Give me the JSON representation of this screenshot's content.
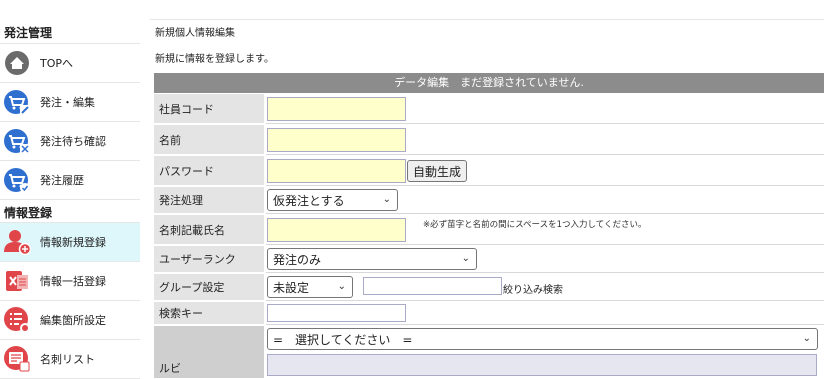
{
  "sidebar": {
    "order_section": "発注管理",
    "order_items": [
      {
        "label": "TOPへ",
        "icon": "home-icon"
      },
      {
        "label": "発注・編集",
        "icon": "cart-edit-icon"
      },
      {
        "label": "発注待ち確認",
        "icon": "cart-wait-icon"
      },
      {
        "label": "発注履歴",
        "icon": "cart-history-icon"
      }
    ],
    "info_section": "情報登録",
    "info_items": [
      {
        "label": "情報新規登録",
        "icon": "user-add-icon"
      },
      {
        "label": "情報一括登録",
        "icon": "excel-bulk-icon"
      },
      {
        "label": "編集箇所設定",
        "icon": "list-settings-icon"
      },
      {
        "label": "名刺リスト",
        "icon": "card-list-icon"
      }
    ]
  },
  "main": {
    "page_title": "新規個人情報編集",
    "intro": "新規に情報を登録します。",
    "form_header": "データ編集　まだ登録されていません.",
    "fields": {
      "employee_code": {
        "label": "社員コード",
        "value": ""
      },
      "name": {
        "label": "名前",
        "value": ""
      },
      "password": {
        "label": "パスワード",
        "value": "",
        "button": "自動生成"
      },
      "order_processing": {
        "label": "発注処理",
        "selected": "仮発注とする"
      },
      "card_name": {
        "label": "名刺記載氏名",
        "value": "",
        "note": "※必ず苗字と名前の間にスペースを1つ入力してください。"
      },
      "user_rank": {
        "label": "ユーザーランク",
        "selected": "発注のみ"
      },
      "group": {
        "label": "グループ設定",
        "selected": "未設定",
        "filter_value": "",
        "filter_label": "絞り込み検索"
      },
      "search_key": {
        "label": "検索キー",
        "value": ""
      },
      "ruby": {
        "label": "ルビ",
        "selected": "=　選択してください　="
      }
    }
  },
  "colors": {
    "active_bg": "#ddf7fb",
    "header_bg": "#8c8c8c",
    "label_bg": "#e4e4e4",
    "input_bg": "#ffffcc",
    "icon_blue": "#2f6fd0",
    "icon_red": "#e0454a",
    "icon_gray": "#6b6b6b"
  }
}
